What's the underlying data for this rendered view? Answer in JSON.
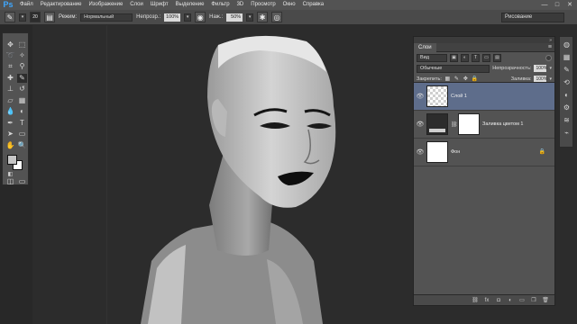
{
  "app": {
    "logo": "Ps",
    "menu": [
      "Файл",
      "Редактирование",
      "Изображение",
      "Слои",
      "Шрифт",
      "Выделение",
      "Фильтр",
      "3D",
      "Просмотр",
      "Окно",
      "Справка"
    ],
    "window_controls": [
      "—",
      "□",
      "✕"
    ]
  },
  "options_bar": {
    "brush_size": "20",
    "mode_label": "Режим:",
    "mode_value": "Нормальный",
    "opacity_label": "Непрозр.:",
    "opacity_value": "100%",
    "flow_label": "Наж.:",
    "flow_value": "50%",
    "workspace": "Рисование"
  },
  "layers_panel": {
    "tab": "Слои",
    "filter_kind": "Вид",
    "blend_mode": "Обычные",
    "opacity_label": "Непрозрачность:",
    "opacity_value": "100%",
    "lock_label": "Закрепить:",
    "fill_label": "Заливка:",
    "fill_value": "100%",
    "layers": [
      {
        "name": "Слой 1",
        "selected": true
      },
      {
        "name": "Заливка цветом 1",
        "selected": false
      },
      {
        "name": "Фон",
        "selected": false
      }
    ],
    "footer_icons": [
      "link-icon",
      "fx-icon",
      "mask-icon",
      "adjustment-icon",
      "group-icon",
      "new-layer-icon",
      "trash-icon"
    ]
  },
  "colors": {
    "chrome": "#535353",
    "canvas_bg": "#2c2c2c",
    "selection": "#5e6d8b",
    "accent": "#3ea7ff"
  }
}
